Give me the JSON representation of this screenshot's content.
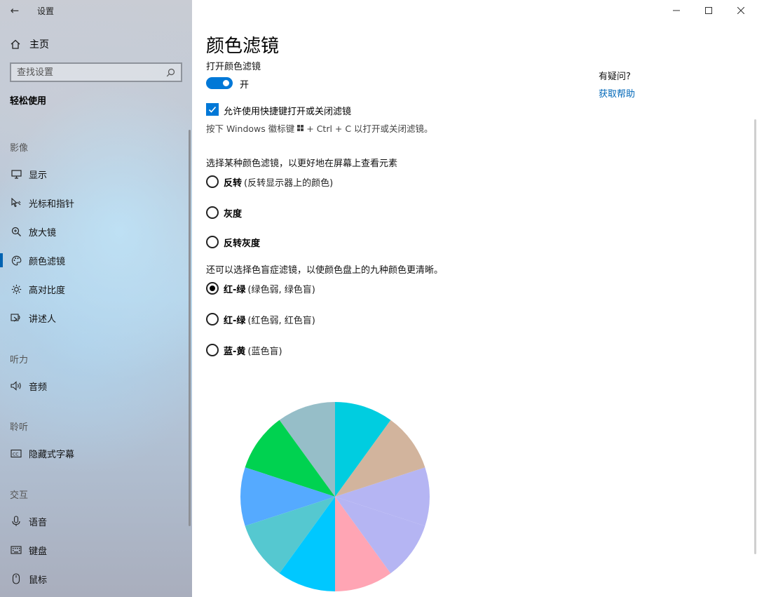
{
  "window": {
    "app_title": "设置",
    "back_glyph": "←",
    "minimize_glyph": "—",
    "maximize_glyph": "☐",
    "close_glyph": "✕"
  },
  "sidebar": {
    "home_label": "主页",
    "search_placeholder": "查找设置",
    "category": "轻松使用",
    "sections": {
      "vision": "影像",
      "hearing": "听力",
      "listening": "聆听",
      "interaction": "交互"
    },
    "items": [
      {
        "label": "显示",
        "icon": "monitor-icon"
      },
      {
        "label": "光标和指针",
        "icon": "cursor-icon"
      },
      {
        "label": "放大镜",
        "icon": "magnifier-icon"
      },
      {
        "label": "颜色滤镜",
        "icon": "palette-icon",
        "active": true
      },
      {
        "label": "高对比度",
        "icon": "brightness-icon"
      },
      {
        "label": "讲述人",
        "icon": "narrator-icon"
      },
      {
        "label": "音频",
        "icon": "speaker-icon"
      },
      {
        "label": "隐藏式字幕",
        "icon": "captions-icon"
      },
      {
        "label": "语音",
        "icon": "microphone-icon"
      },
      {
        "label": "键盘",
        "icon": "keyboard-icon"
      },
      {
        "label": "鼠标",
        "icon": "mouse-icon"
      }
    ]
  },
  "main": {
    "title": "颜色滤镜",
    "toggle_label": "打开颜色滤镜",
    "toggle_state": "开",
    "toggle_on": true,
    "shortcut_checkbox_label": "允许使用快捷键打开或关闭滤镜",
    "shortcut_checked": true,
    "shortcut_hint_prefix": "按下 Windows 徽标键",
    "shortcut_hint_suffix": "+ Ctrl + C 以打开或关闭滤镜。",
    "filter_prompt": "选择某种颜色滤镜，以更好地在屏幕上查看元素",
    "filters": [
      {
        "name": "反转",
        "desc": "(反转显示器上的颜色)",
        "checked": false
      },
      {
        "name": "灰度",
        "desc": "",
        "checked": false
      },
      {
        "name": "反转灰度",
        "desc": "",
        "checked": false
      }
    ],
    "colorblind_prompt": "还可以选择色盲症滤镜，以使颜色盘上的九种颜色更清晰。",
    "colorblind_filters": [
      {
        "name": "红-绿",
        "desc": "(绿色弱, 绿色盲)",
        "checked": true
      },
      {
        "name": "红-绿",
        "desc": "(红色弱, 红色盲)",
        "checked": false
      },
      {
        "name": "蓝-黄",
        "desc": "(蓝色盲)",
        "checked": false
      }
    ],
    "help_title": "有疑问?",
    "help_link": "获取帮助"
  },
  "colors": {
    "accent": "#0078d7",
    "link": "#0067b8"
  },
  "color_wheel": {
    "segments": [
      {
        "color": "#b5b5f3"
      },
      {
        "color": "#d2b49d"
      },
      {
        "color": "#00cde0"
      },
      {
        "color": "#96bec8"
      },
      {
        "color": "#00d250"
      },
      {
        "color": "#55aaff"
      },
      {
        "color": "#55c8d0"
      },
      {
        "color": "#00c8ff"
      },
      {
        "color": "#ffa5b4"
      },
      {
        "color": "#b5b5f3"
      }
    ]
  }
}
